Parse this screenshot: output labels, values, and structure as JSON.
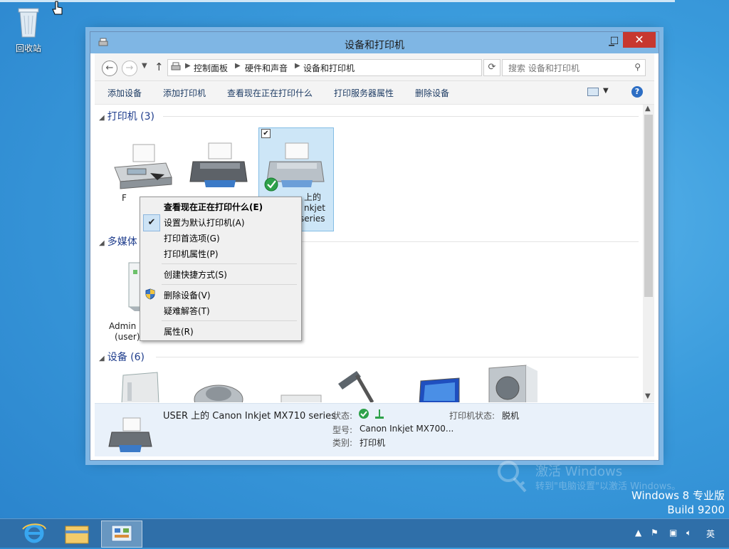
{
  "desktop": {
    "recycle_bin_label": "回收站"
  },
  "window": {
    "title": "设备和打印机",
    "close_glyph": "✕",
    "min_glyph": "▁",
    "max_glyph": "☐"
  },
  "address_bar": {
    "breadcrumbs": [
      "控制面板",
      "硬件和声音",
      "设备和打印机"
    ],
    "search_placeholder": "搜索 设备和打印机"
  },
  "toolbar": {
    "items": [
      "添加设备",
      "添加打印机",
      "查看现在正在打印什么",
      "打印服务器属性",
      "删除设备"
    ]
  },
  "groups": {
    "printers": "打印机 (3)",
    "multimedia": "多媒体",
    "devices": "设备 (6)"
  },
  "devices": {
    "printer1_name": "F",
    "printer3_name_lines": [
      "上的",
      "nkjet",
      "series"
    ],
    "media1_name": [
      "Admin",
      "(user)"
    ]
  },
  "context_menu": {
    "items": [
      "查看现在正在打印什么(E)",
      "设置为默认打印机(A)",
      "打印首选项(G)",
      "打印机属性(P)",
      "创建快捷方式(S)",
      "删除设备(V)",
      "疑难解答(T)",
      "属性(R)"
    ]
  },
  "status_pane": {
    "title": "USER 上的 Canon Inkjet MX710 series",
    "state_label": "状态:",
    "printer_state_label": "打印机状态:",
    "printer_state_value": "脱机",
    "model_label": "型号:",
    "model_value": "Canon Inkjet MX700...",
    "category_label": "类别:",
    "category_value": "打印机"
  },
  "watermark": {
    "activate": "激活 Windows",
    "hint": "转到\"电脑设置\"以激活 Windows。",
    "edition": "Windows 8 专业版",
    "build": "Build 9200"
  },
  "taskbar": {
    "ime": "英"
  }
}
